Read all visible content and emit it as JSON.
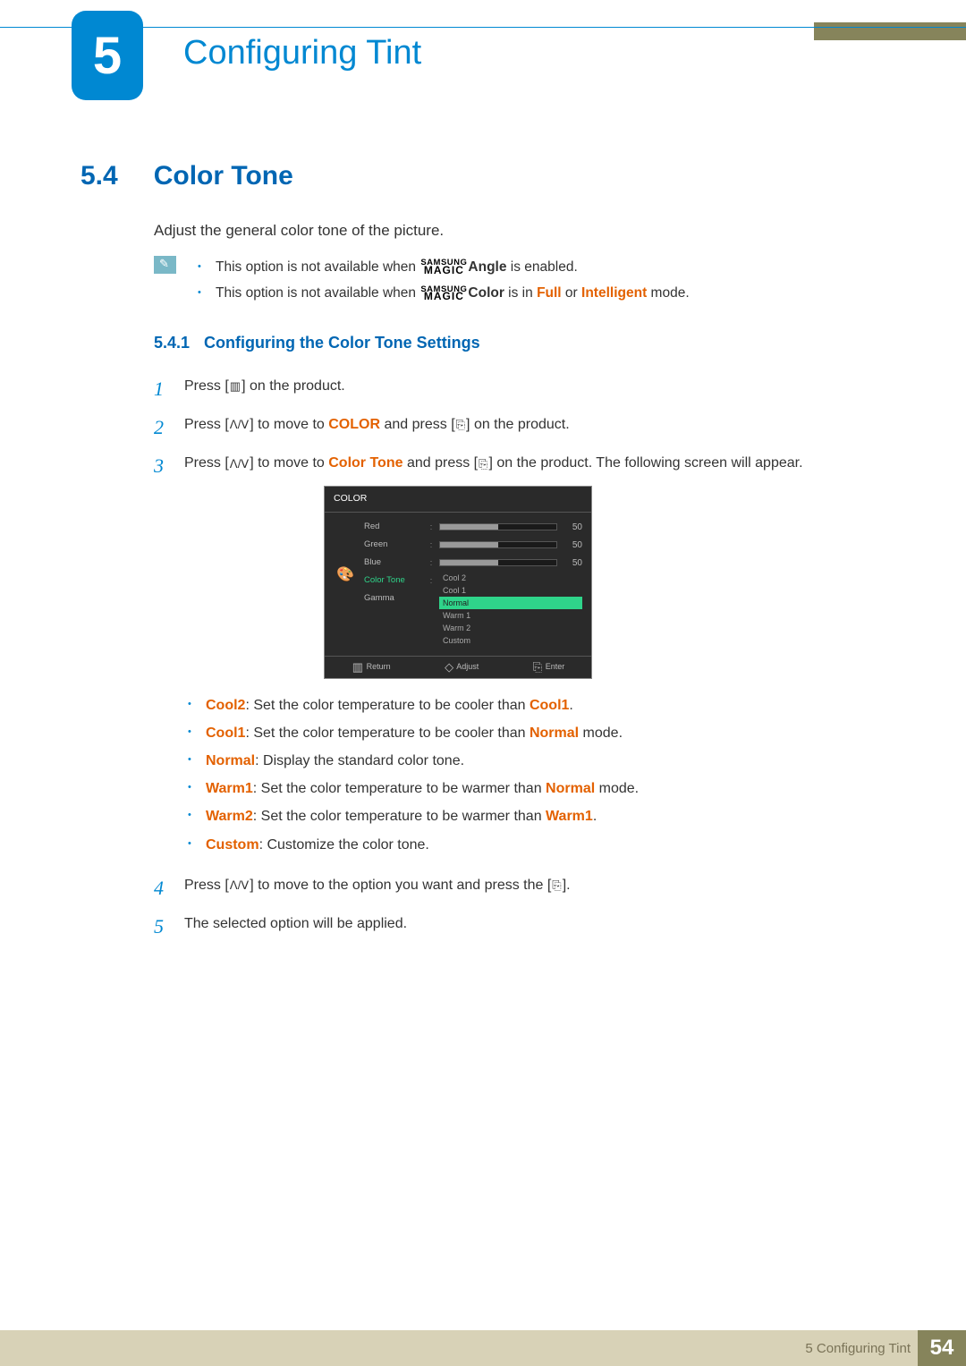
{
  "chapter": {
    "number": "5",
    "title": "Configuring Tint"
  },
  "section": {
    "number": "5.4",
    "title": "Color Tone"
  },
  "intro": "Adjust the general color tone of the picture.",
  "magic_logo": {
    "line1": "SAMSUNG",
    "line2": "MAGIC"
  },
  "notes": [
    {
      "pre": "This option is not available when ",
      "term": "Angle",
      "post": " is enabled."
    },
    {
      "pre": "This option is not available when ",
      "term": "Color",
      "post": " is in ",
      "term2": "Full",
      "mid": " or ",
      "term3": "Intelligent",
      "end": " mode."
    }
  ],
  "subsection": {
    "number": "5.4.1",
    "title": "Configuring the Color Tone Settings"
  },
  "icons": {
    "menu": "▥",
    "updown": "ᐱ/ᐯ",
    "enter": "⎘",
    "adjust": "◇"
  },
  "steps": {
    "s1": {
      "pre": "Press [",
      "post": "] on the product."
    },
    "s2": {
      "pre": "Press [",
      "mid1": "] to move to ",
      "target": "COLOR",
      "mid2": " and press [",
      "post": "] on the product."
    },
    "s3": {
      "pre": "Press [",
      "mid1": "] to move to ",
      "target": "Color Tone",
      "mid2": " and press [",
      "post": "] on the product. The following screen will appear."
    },
    "s4": {
      "pre": "Press [",
      "mid": "] to move to the option you want and press the [",
      "post": "]."
    },
    "s5": "The selected option will be applied."
  },
  "osd": {
    "title": "COLOR",
    "rows": [
      {
        "label": "Red",
        "value": "50"
      },
      {
        "label": "Green",
        "value": "50"
      },
      {
        "label": "Blue",
        "value": "50"
      }
    ],
    "selected_label": "Color Tone",
    "extra_label": "Gamma",
    "options": [
      "Cool 2",
      "Cool 1",
      "Normal",
      "Warm 1",
      "Warm 2",
      "Custom"
    ],
    "selected_option": "Normal",
    "footer": {
      "return": "Return",
      "adjust": "Adjust",
      "enter": "Enter"
    }
  },
  "tone_options": [
    {
      "name": "Cool2",
      "desc": ": Set the color temperature to be cooler than ",
      "ref": "Cool1",
      "end": "."
    },
    {
      "name": "Cool1",
      "desc": ": Set the color temperature to be cooler than ",
      "ref": "Normal",
      "end": " mode."
    },
    {
      "name": "Normal",
      "desc": ": Display the standard color tone.",
      "ref": "",
      "end": ""
    },
    {
      "name": "Warm1",
      "desc": ": Set the color temperature to be warmer than ",
      "ref": "Normal",
      "end": " mode."
    },
    {
      "name": "Warm2",
      "desc": ": Set the color temperature to be warmer than ",
      "ref": "Warm1",
      "end": "."
    },
    {
      "name": "Custom",
      "desc": ": Customize the color tone.",
      "ref": "",
      "end": ""
    }
  ],
  "footer": {
    "label": "5 Configuring Tint",
    "page": "54"
  }
}
